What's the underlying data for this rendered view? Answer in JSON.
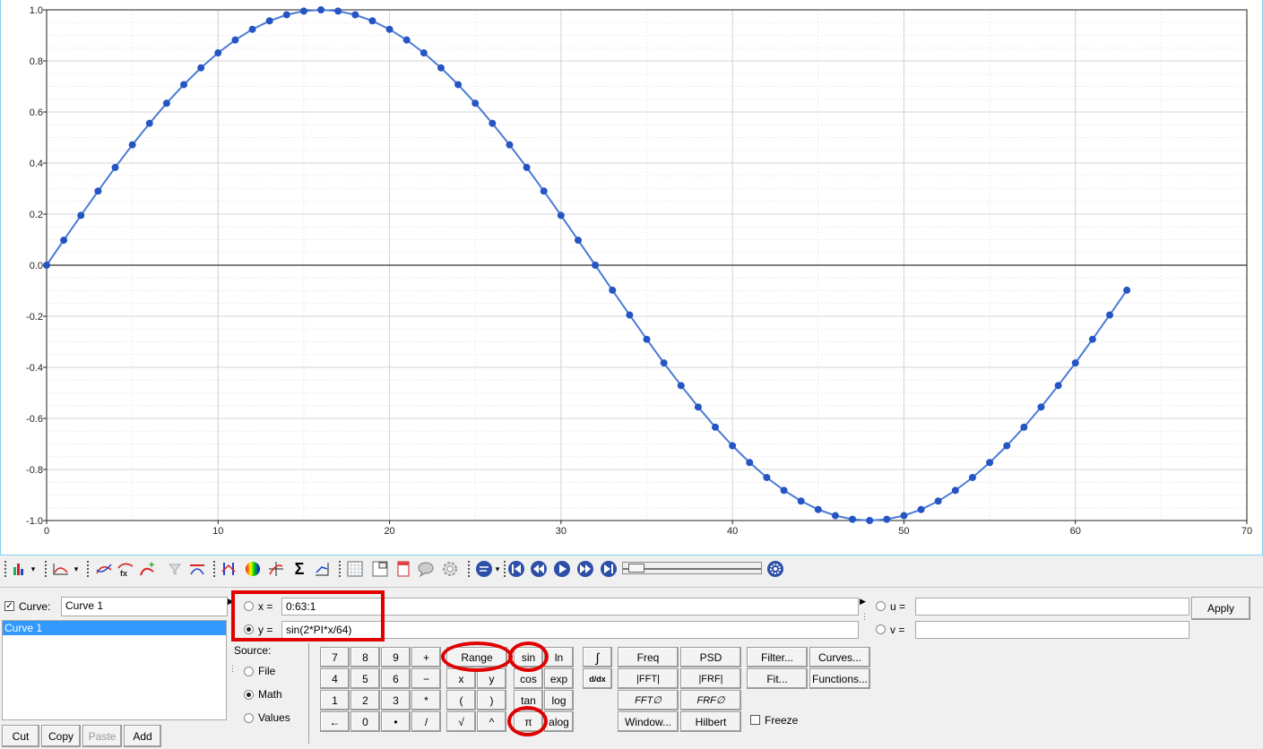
{
  "colors": {
    "curve": "#4a7bd6",
    "marker": "#2455c3",
    "grid": "#d4d4d4",
    "highlight": "#e00000",
    "selection": "#3399ff"
  },
  "chart_data": {
    "type": "line",
    "x": [
      0,
      1,
      2,
      3,
      4,
      5,
      6,
      7,
      8,
      9,
      10,
      11,
      12,
      13,
      14,
      15,
      16,
      17,
      18,
      19,
      20,
      21,
      22,
      23,
      24,
      25,
      26,
      27,
      28,
      29,
      30,
      31,
      32,
      33,
      34,
      35,
      36,
      37,
      38,
      39,
      40,
      41,
      42,
      43,
      44,
      45,
      46,
      47,
      48,
      49,
      50,
      51,
      52,
      53,
      54,
      55,
      56,
      57,
      58,
      59,
      60,
      61,
      62,
      63
    ],
    "series": [
      {
        "y_expression": "sin(2*PI*x/64)",
        "markers": true
      }
    ],
    "xlim": [
      0,
      70
    ],
    "ylim": [
      -1.0,
      1.0
    ],
    "x_ticks": [
      "0",
      "10",
      "20",
      "30",
      "40",
      "50",
      "60",
      "70"
    ],
    "y_ticks": [
      "1.0",
      "0.8",
      "0.6",
      "0.4",
      "0.2",
      "0.0",
      "-0.2",
      "-0.4",
      "-0.6",
      "-0.8",
      "-1.0"
    ],
    "grid": true,
    "legend": "none"
  },
  "toolbar": {
    "icons": [
      "plot-type-icon",
      "curve-type-icon",
      "curve-edit-icon",
      "curve-fx-icon",
      "add-curve-icon",
      "add-icon",
      "filter-icon",
      "remove-icon",
      "axes-icon",
      "color-icon",
      "crosshair-icon",
      "sum-icon",
      "axis-scale-icon",
      "grid-icon",
      "legend-icon",
      "notes-icon",
      "comment-icon",
      "settings-icon",
      "animation-icon",
      "first-frame-icon",
      "prev-frame-icon",
      "play-icon",
      "next-frame-icon",
      "last-frame-icon",
      "options-icon"
    ]
  },
  "curve_panel": {
    "curve_label": "Curve:",
    "curve_name": "Curve 1",
    "list_items": [
      "Curve 1"
    ],
    "buttons": [
      "Cut",
      "Copy",
      "Paste",
      "Add"
    ]
  },
  "expr": {
    "x_label": "x =",
    "x_value": "0:63:1",
    "y_label": "y =",
    "y_value": "sin(2*PI*x/64)",
    "u_label": "u =",
    "u_value": "",
    "v_label": "v =",
    "v_value": "",
    "apply": "Apply"
  },
  "source": {
    "label": "Source:",
    "options": [
      "File",
      "Math",
      "Values"
    ],
    "selected": "Math"
  },
  "keypad": {
    "row1": [
      "7",
      "8",
      "9",
      "+",
      "Range",
      "sin",
      "ln",
      "∫"
    ],
    "row2": [
      "4",
      "5",
      "6",
      "−",
      "x",
      "y",
      "cos",
      "exp",
      "d/dx"
    ],
    "row3": [
      "1",
      "2",
      "3",
      "*",
      "(",
      ")",
      "tan",
      "log"
    ],
    "row4": [
      "←",
      "0",
      "•",
      "/",
      "√",
      "^",
      "π",
      "alog"
    ]
  },
  "functions": {
    "col1": [
      "Freq",
      "|FFT|",
      "FFT∅",
      "Window..."
    ],
    "col2": [
      "PSD",
      "|FRF|",
      "FRF∅",
      "Hilbert"
    ],
    "col3": [
      "Filter...",
      "Fit..."
    ],
    "col4": [
      "Curves...",
      "Functions..."
    ],
    "freeze": "Freeze"
  }
}
